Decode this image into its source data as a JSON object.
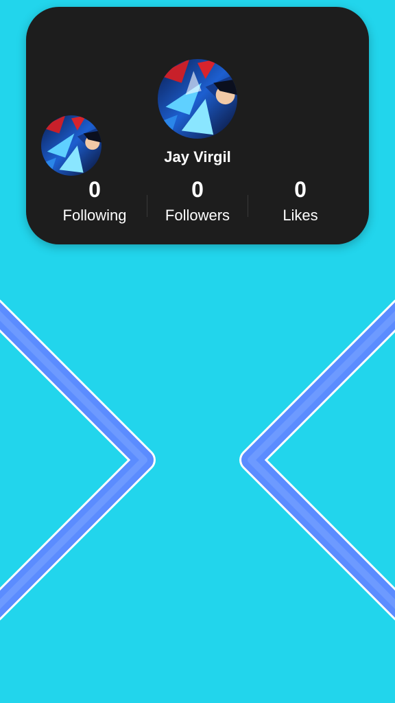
{
  "profile": {
    "name": "Jay Virgil",
    "stats": [
      {
        "value": "0",
        "label": "Following"
      },
      {
        "value": "0",
        "label": "Followers"
      },
      {
        "value": "0",
        "label": "Likes"
      }
    ]
  },
  "colors": {
    "background": "#22d5ec",
    "card": "#1d1d1d",
    "chevron": "#5b8cff"
  },
  "icons": {
    "left_chevron": "chevron-left-icon",
    "right_chevron": "chevron-right-icon"
  }
}
